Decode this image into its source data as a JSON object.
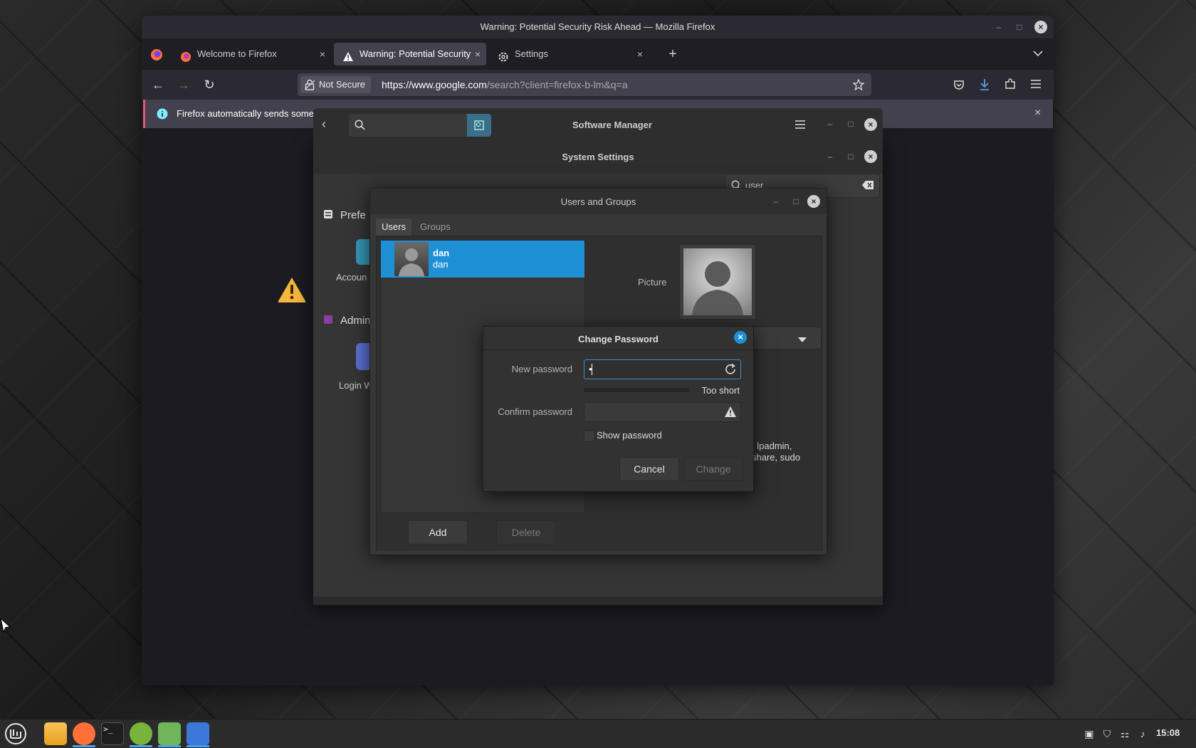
{
  "firefox": {
    "window_title": "Warning: Potential Security Risk Ahead — Mozilla Firefox",
    "tabs": [
      {
        "label": "Welcome to Firefox",
        "close": "×"
      },
      {
        "label": "Warning: Potential Security",
        "close": "×"
      },
      {
        "label": "Settings",
        "close": "×"
      }
    ],
    "new_tab": "+",
    "security_label": "Not Secure",
    "url_host": "https://www.google.com",
    "url_rest": "/search?client=firefox-b-lm&q=a",
    "info_text": "Firefox automatically sends some",
    "info_close": "×"
  },
  "software_manager": {
    "title": "Software Manager",
    "min": "–",
    "max": "□",
    "close": "×"
  },
  "system_settings": {
    "title": "System Settings",
    "search_value": "user",
    "section_pref": "Prefe",
    "accounts_label": "Accoun",
    "section_admin": "Admin",
    "login_label": "Login W",
    "min": "–",
    "max": "□",
    "close": "×"
  },
  "users_groups": {
    "title": "Users and Groups",
    "tabs": [
      "Users",
      "Groups"
    ],
    "user": {
      "name": "dan",
      "username": "dan"
    },
    "picture_label": "Picture",
    "groups_text_1": ", lpadmin,",
    "groups_text_2": "share, sudo",
    "add_label": "Add",
    "delete_label": "Delete",
    "min": "–",
    "max": "□",
    "close": "×"
  },
  "change_password": {
    "title": "Change Password",
    "new_password_label": "New password",
    "new_password_value": "•",
    "strength_text": "Too short",
    "strength_fraction": 0,
    "confirm_label": "Confirm password",
    "confirm_value": "",
    "show_password_label": "Show password",
    "show_password_checked": false,
    "cancel_label": "Cancel",
    "change_label": "Change"
  },
  "taskbar": {
    "clock": "15:08",
    "apps": [
      "menu-icon",
      "files-icon",
      "firefox-icon",
      "terminal-icon",
      "software-manager-icon",
      "system-settings-icon",
      "users-groups-icon"
    ]
  },
  "colors": {
    "accent": "#1e90d6",
    "warning": "#f6b73c",
    "infobar_accent": "#e6567a"
  }
}
